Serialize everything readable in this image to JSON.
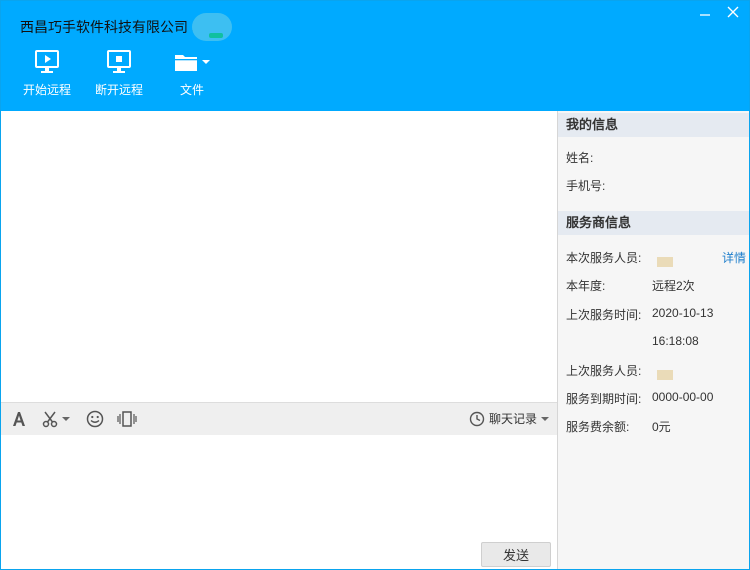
{
  "window": {
    "title": "西昌巧手软件科技有限公司 >",
    "minimize_icon": "minimize-icon",
    "close_icon": "close-icon"
  },
  "toolbar": {
    "start_remote": "开始远程",
    "stop_remote": "断开远程",
    "file": "文件"
  },
  "input_bar": {
    "chat_history": "聊天记录"
  },
  "send_button": "发送",
  "my_info": {
    "header": "我的信息",
    "name_label": "姓名:",
    "phone_label": "手机号:"
  },
  "provider_info": {
    "header": "服务商信息",
    "current_staff_label": "本次服务人员:",
    "details_link": "详情",
    "year_label": "本年度:",
    "year_value": "远程2次",
    "last_time_label": "上次服务时间:",
    "last_time_date": "2020-10-13",
    "last_time_clock": "16:18:08",
    "last_staff_label": "上次服务人员:",
    "expiry_label": "服务到期时间:",
    "expiry_value": "0000-00-00",
    "balance_label": "服务费余额:",
    "balance_value": "0元"
  },
  "colors": {
    "header_bg": "#00aaff",
    "link": "#1f7fcc"
  }
}
